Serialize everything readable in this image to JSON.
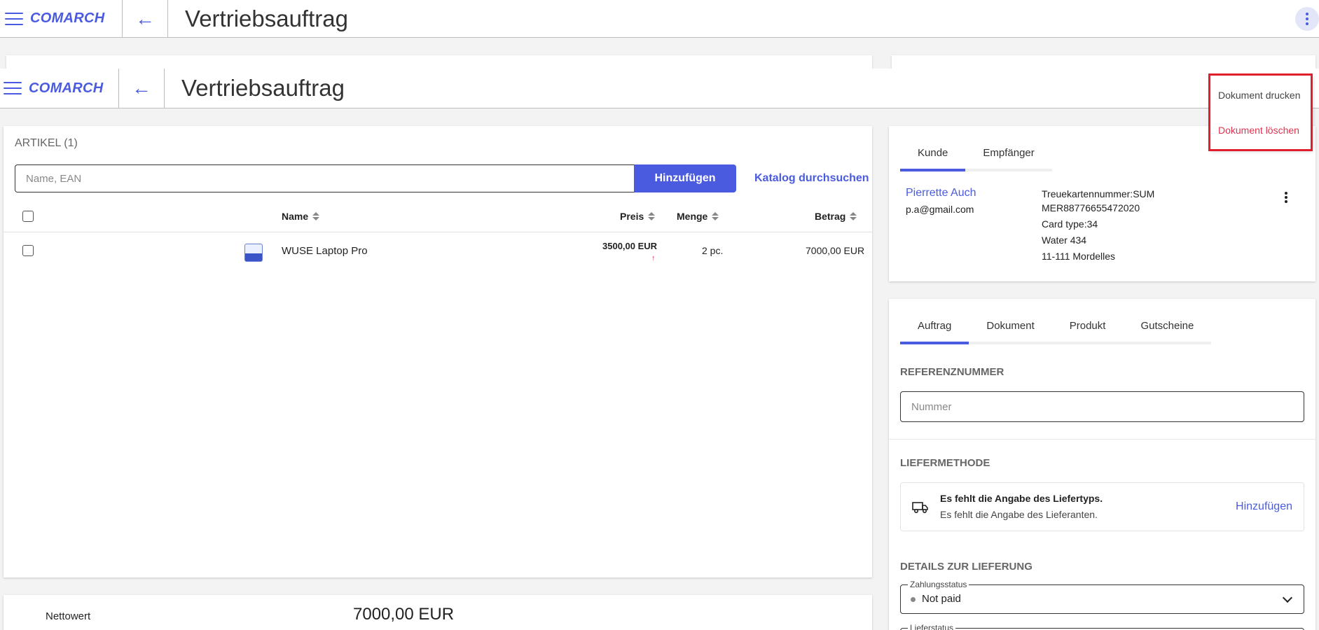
{
  "app": {
    "logo": "COMARCH",
    "title": "Vertriebsauftrag"
  },
  "articles": {
    "title": "ARTIKEL (1)",
    "search_placeholder": "Name, EAN",
    "add_button": "Hinzufügen",
    "catalog_link": "Katalog durchsuchen",
    "columns": {
      "name": "Name",
      "price": "Preis",
      "quantity": "Menge",
      "amount": "Betrag"
    },
    "rows": [
      {
        "name": "WUSE Laptop Pro",
        "price": "3500,00 EUR",
        "price_indicator": "↑",
        "quantity": "2 pc.",
        "amount": "7000,00 EUR"
      }
    ]
  },
  "totals": {
    "label": "Nettowert",
    "value": "7000,00 EUR"
  },
  "customer": {
    "tabs": [
      "Kunde",
      "Empfänger"
    ],
    "active_tab": 0,
    "name": "Pierrette Auch",
    "email": "p.a@gmail.com",
    "loyalty_line1": "Treuekartennummer:SUM",
    "loyalty_line2": "MER88776655472020",
    "card_type": "Card type:34",
    "street": "Water 434",
    "city": "11-111 Mordelles"
  },
  "order": {
    "tabs": [
      "Auftrag",
      "Dokument",
      "Produkt",
      "Gutscheine"
    ],
    "active_tab": 0,
    "reference_title": "REFERENZNUMMER",
    "reference_placeholder": "Nummer",
    "delivery_method_title": "LIEFERMETHODE",
    "delivery_missing_type": "Es fehlt die Angabe des Liefertyps.",
    "delivery_missing_supplier": "Es fehlt die Angabe des Lieferanten.",
    "delivery_add": "Hinzufügen",
    "delivery_details_title": "DETAILS ZUR LIEFERUNG",
    "payment_status_label": "Zahlungsstatus",
    "payment_status_value": "Not paid",
    "delivery_status_label": "Lieferstatus"
  },
  "menu": {
    "items": [
      "Dokument drucken",
      "Dokument löschen"
    ]
  },
  "colors": {
    "accent": "#4a5be0",
    "danger": "#e0334f",
    "highlight": "#e01e2d"
  }
}
